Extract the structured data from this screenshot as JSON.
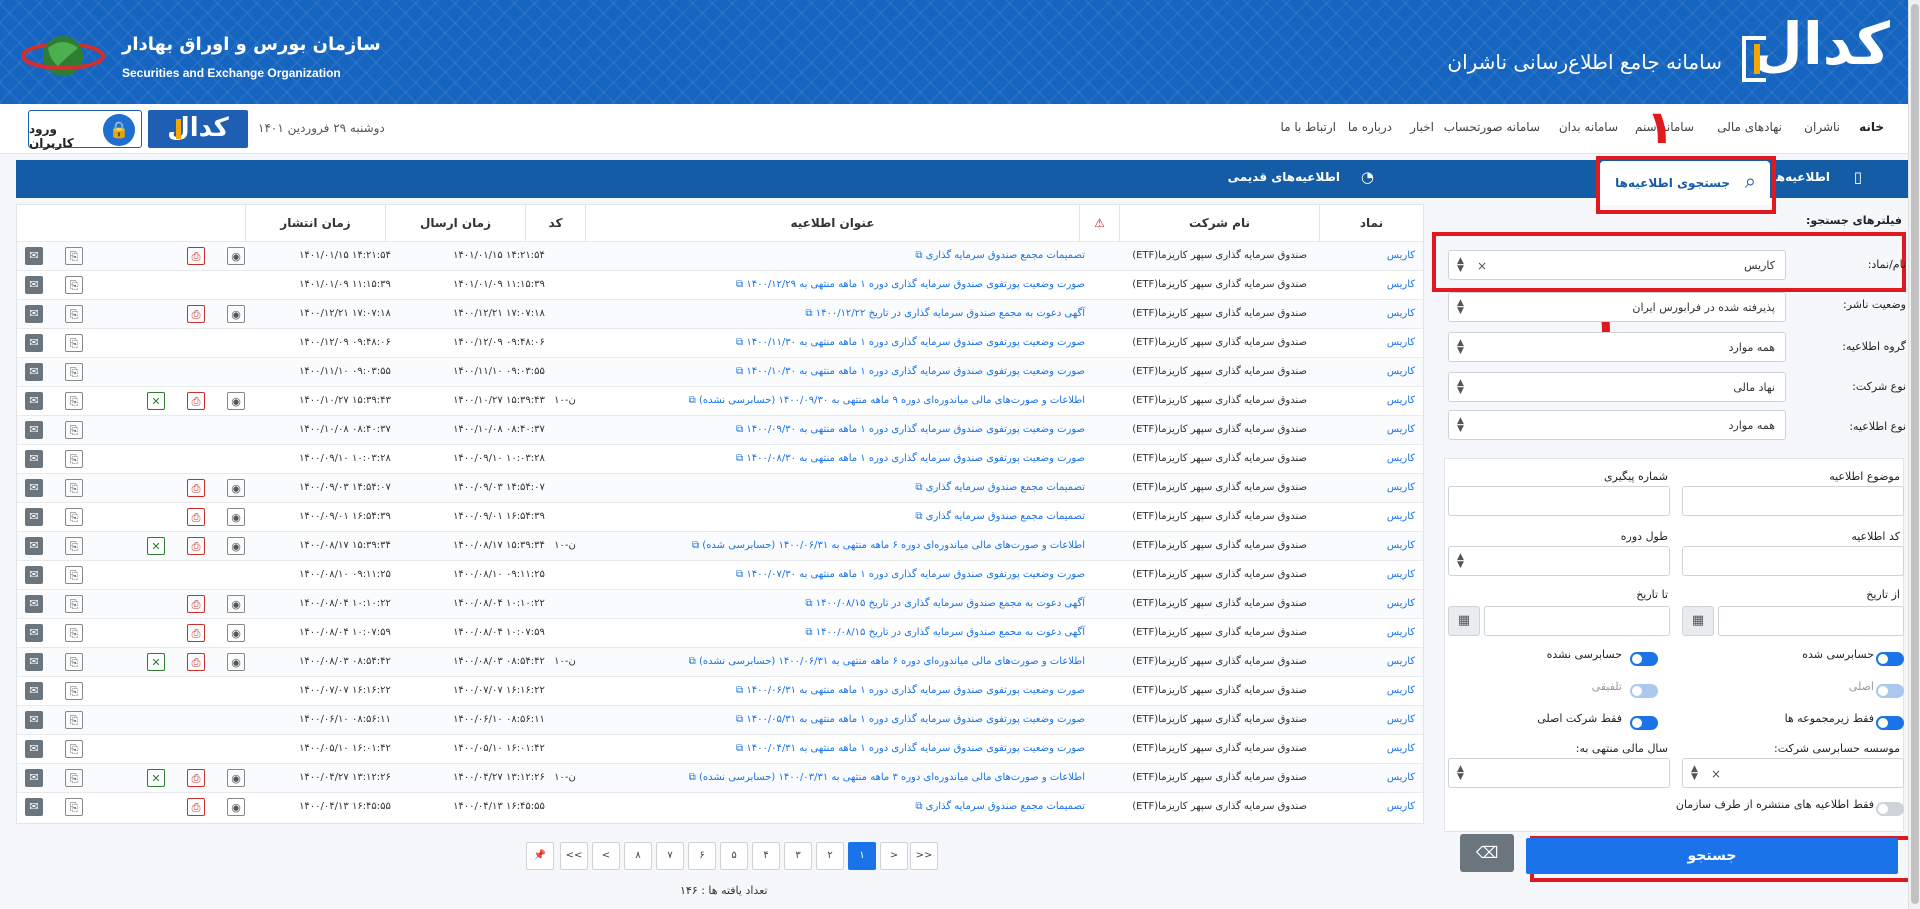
{
  "header": {
    "brand_logo": "کدال",
    "title": "سامانه جامع اطلاع‌رسانی ناشران",
    "org_fa": "سازمان بورس و اوراق بهادار",
    "org_en": "Securities and Exchange Organization"
  },
  "nav": {
    "items": [
      "خانه",
      "ناشران",
      "نهادهای مالی",
      "سامانه سنم",
      "سامانه بدان",
      "سامانه صورتحساب",
      "اخبار",
      "درباره ما",
      "ارتباط با ما"
    ],
    "login": "ورود کاربران",
    "codal_small": "کدال",
    "date": "دوشنبه ۲۹ فروردین ۱۴۰۱"
  },
  "tabs": {
    "notices": "اطلاعیه‌ها",
    "search": "جستجوی اطلاعیه‌ها",
    "old": "اطلاعیه‌های قدیمی"
  },
  "annotations": [
    "۱",
    "۲",
    "۳"
  ],
  "filters": {
    "heading": "فیلترهای جستجو:",
    "symbol_label": "نام/نماد:",
    "symbol_value": "کاریس",
    "publisher_status_label": "وضعیت ناشر:",
    "publisher_status_value": "پذیرفته شده در فرابورس ایران",
    "notice_group_label": "گروه اطلاعیه:",
    "notice_group_value": "همه موارد",
    "company_type_label": "نوع شرکت:",
    "company_type_value": "نهاد مالی",
    "notice_type_label": "نوع اطلاعیه:",
    "notice_type_value": "همه موارد",
    "subject_label": "موضوع اطلاعیه",
    "tracking_label": "شماره پیگیری",
    "code_label": "کد اطلاعیه",
    "period_label": "طول دوره",
    "from_label": "از تاریخ",
    "to_label": "تا تاریخ",
    "audited": "حسابرسی شده",
    "not_audited": "حسابرسی نشده",
    "original": "اصلی",
    "consolidated": "تلفیقی",
    "subsidiaries_only": "فقط زیرمجموعه ها",
    "parent_only": "فقط شرکت اصلی",
    "audit_firm_label": "موسسه حسابرسی شرکت:",
    "fiscal_year_label": "سال مالی منتهی به:",
    "org_only": "فقط اطلاعیه های منتشره از طرف سازمان",
    "search_btn": "جستجو"
  },
  "table": {
    "headers": {
      "symbol": "نماد",
      "company": "نام شرکت",
      "title": "عنوان اطلاعیه",
      "code": "کد",
      "sent": "زمان ارسال",
      "published": "زمان انتشار"
    },
    "rows": [
      {
        "symbol": "کاریس",
        "company": "صندوق سرمایه گذاری سپهر کاریزما(ETF)",
        "title": "تصمیمات مجمع صندوق سرمایه گذاری",
        "code": "",
        "sent": "۱۴۰۱/۰۱/۱۵ ۱۴:۲۱:۵۴",
        "pub": "۱۴۰۱/۰۱/۱۵ ۱۴:۲۱:۵۴",
        "icons": [
          "msg",
          "clip",
          "pdf",
          "eye"
        ]
      },
      {
        "symbol": "کاریس",
        "company": "صندوق سرمایه گذاری سپهر کاریزما(ETF)",
        "title": "صورت وضعیت پورتفوی صندوق سرمایه گذاری دوره ۱ ماهه منتهی به ۱۴۰۰/۱۲/۲۹",
        "code": "",
        "sent": "۱۴۰۱/۰۱/۰۹ ۱۱:۱۵:۳۹",
        "pub": "۱۴۰۱/۰۱/۰۹ ۱۱:۱۵:۳۹",
        "icons": [
          "msg",
          "clip"
        ]
      },
      {
        "symbol": "کاریس",
        "company": "صندوق سرمایه گذاری سپهر کاریزما(ETF)",
        "title": "آگهی دعوت به مجمع صندوق سرمایه گذاری در تاریخ ۱۴۰۰/۱۲/۲۲",
        "code": "",
        "sent": "۱۴۰۰/۱۲/۲۱ ۱۷:۰۷:۱۸",
        "pub": "۱۴۰۰/۱۲/۲۱ ۱۷:۰۷:۱۸",
        "icons": [
          "msg",
          "clip",
          "pdf",
          "eye"
        ]
      },
      {
        "symbol": "کاریس",
        "company": "صندوق سرمایه گذاری سپهر کاریزما(ETF)",
        "title": "صورت وضعیت پورتفوی صندوق سرمایه گذاری دوره ۱ ماهه منتهی به ۱۴۰۰/۱۱/۳۰",
        "code": "",
        "sent": "۱۴۰۰/۱۲/۰۹ ۰۹:۴۸:۰۶",
        "pub": "۱۴۰۰/۱۲/۰۹ ۰۹:۴۸:۰۶",
        "icons": [
          "msg",
          "clip"
        ]
      },
      {
        "symbol": "کاریس",
        "company": "صندوق سرمایه گذاری سپهر کاریزما(ETF)",
        "title": "صورت وضعیت پورتفوی صندوق سرمایه گذاری دوره ۱ ماهه منتهی به ۱۴۰۰/۱۰/۳۰",
        "code": "",
        "sent": "۱۴۰۰/۱۱/۱۰ ۰۹:۰۳:۵۵",
        "pub": "۱۴۰۰/۱۱/۱۰ ۰۹:۰۳:۵۵",
        "icons": [
          "msg",
          "clip"
        ]
      },
      {
        "symbol": "کاریس",
        "company": "صندوق سرمایه گذاری سپهر کاریزما(ETF)",
        "title": "اطلاعات و صورت‌های مالی میاندوره‌ای دوره ۹ ماهه منتهی به ۱۴۰۰/۰۹/۳۰ (حسابرسی نشده)",
        "code": "ن-۱۰",
        "sent": "۱۴۰۰/۱۰/۲۷ ۱۵:۳۹:۴۳",
        "pub": "۱۴۰۰/۱۰/۲۷ ۱۵:۳۹:۴۳",
        "icons": [
          "msg",
          "clip",
          "xls",
          "pdf",
          "eye"
        ]
      },
      {
        "symbol": "کاریس",
        "company": "صندوق سرمایه گذاری سپهر کاریزما(ETF)",
        "title": "صورت وضعیت پورتفوی صندوق سرمایه گذاری دوره ۱ ماهه منتهی به ۱۴۰۰/۰۹/۳۰",
        "code": "",
        "sent": "۱۴۰۰/۱۰/۰۸ ۰۸:۴۰:۳۷",
        "pub": "۱۴۰۰/۱۰/۰۸ ۰۸:۴۰:۳۷",
        "icons": [
          "msg",
          "clip"
        ]
      },
      {
        "symbol": "کاریس",
        "company": "صندوق سرمایه گذاری سپهر کاریزما(ETF)",
        "title": "صورت وضعیت پورتفوی صندوق سرمایه گذاری دوره ۱ ماهه منتهی به ۱۴۰۰/۰۸/۳۰",
        "code": "",
        "sent": "۱۴۰۰/۰۹/۱۰ ۱۰:۰۳:۲۸",
        "pub": "۱۴۰۰/۰۹/۱۰ ۱۰:۰۳:۲۸",
        "icons": [
          "msg",
          "clip"
        ]
      },
      {
        "symbol": "کاریس",
        "company": "صندوق سرمایه گذاری سپهر کاریزما(ETF)",
        "title": "تصمیمات مجمع صندوق سرمایه گذاری",
        "code": "",
        "sent": "۱۴۰۰/۰۹/۰۳ ۱۴:۵۴:۰۷",
        "pub": "۱۴۰۰/۰۹/۰۳ ۱۴:۵۴:۰۷",
        "icons": [
          "msg",
          "clip",
          "pdf",
          "eye"
        ]
      },
      {
        "symbol": "کاریس",
        "company": "صندوق سرمایه گذاری سپهر کاریزما(ETF)",
        "title": "تصمیمات مجمع صندوق سرمایه گذاری",
        "code": "",
        "sent": "۱۴۰۰/۰۹/۰۱ ۱۶:۵۴:۳۹",
        "pub": "۱۴۰۰/۰۹/۰۱ ۱۶:۵۴:۳۹",
        "icons": [
          "msg",
          "clip",
          "pdf",
          "eye"
        ]
      },
      {
        "symbol": "کاریس",
        "company": "صندوق سرمایه گذاری سپهر کاریزما(ETF)",
        "title": "اطلاعات و صورت‌های مالی میاندوره‌ای دوره ۶ ماهه منتهی به ۱۴۰۰/۰۶/۳۱ (حسابرسی شده)",
        "code": "ن-۱۰",
        "sent": "۱۴۰۰/۰۸/۱۷ ۱۵:۳۹:۳۴",
        "pub": "۱۴۰۰/۰۸/۱۷ ۱۵:۳۹:۳۴",
        "icons": [
          "msg",
          "clip",
          "xls",
          "pdf",
          "eye"
        ]
      },
      {
        "symbol": "کاریس",
        "company": "صندوق سرمایه گذاری سپهر کاریزما(ETF)",
        "title": "صورت وضعیت پورتفوی صندوق سرمایه گذاری دوره ۱ ماهه منتهی به ۱۴۰۰/۰۷/۳۰",
        "code": "",
        "sent": "۱۴۰۰/۰۸/۱۰ ۰۹:۱۱:۲۵",
        "pub": "۱۴۰۰/۰۸/۱۰ ۰۹:۱۱:۲۵",
        "icons": [
          "msg",
          "clip"
        ]
      },
      {
        "symbol": "کاریس",
        "company": "صندوق سرمایه گذاری سپهر کاریزما(ETF)",
        "title": "آگهی دعوت به مجمع صندوق سرمایه گذاری در تاریخ ۱۴۰۰/۰۸/۱۵",
        "code": "",
        "sent": "۱۴۰۰/۰۸/۰۴ ۱۰:۱۰:۲۲",
        "pub": "۱۴۰۰/۰۸/۰۴ ۱۰:۱۰:۲۲",
        "icons": [
          "msg",
          "clip",
          "pdf",
          "eye"
        ]
      },
      {
        "symbol": "کاریس",
        "company": "صندوق سرمایه گذاری سپهر کاریزما(ETF)",
        "title": "آگهی دعوت به مجمع صندوق سرمایه گذاری در تاریخ ۱۴۰۰/۰۸/۱۵",
        "code": "",
        "sent": "۱۴۰۰/۰۸/۰۴ ۱۰:۰۷:۵۹",
        "pub": "۱۴۰۰/۰۸/۰۴ ۱۰:۰۷:۵۹",
        "icons": [
          "msg",
          "clip",
          "pdf",
          "eye"
        ]
      },
      {
        "symbol": "کاریس",
        "company": "صندوق سرمایه گذاری سپهر کاریزما(ETF)",
        "title": "اطلاعات و صورت‌های مالی میاندوره‌ای دوره ۶ ماهه منتهی به ۱۴۰۰/۰۶/۳۱ (حسابرسی نشده)",
        "code": "ن-۱۰",
        "sent": "۱۴۰۰/۰۸/۰۳ ۰۸:۵۴:۴۲",
        "pub": "۱۴۰۰/۰۸/۰۳ ۰۸:۵۴:۴۲",
        "icons": [
          "msg",
          "clip",
          "xls",
          "pdf",
          "eye"
        ]
      },
      {
        "symbol": "کاریس",
        "company": "صندوق سرمایه گذاری سپهر کاریزما(ETF)",
        "title": "صورت وضعیت پورتفوی صندوق سرمایه گذاری دوره ۱ ماهه منتهی به ۱۴۰۰/۰۶/۳۱",
        "code": "",
        "sent": "۱۴۰۰/۰۷/۰۷ ۱۶:۱۶:۲۲",
        "pub": "۱۴۰۰/۰۷/۰۷ ۱۶:۱۶:۲۲",
        "icons": [
          "msg",
          "clip"
        ]
      },
      {
        "symbol": "کاریس",
        "company": "صندوق سرمایه گذاری سپهر کاریزما(ETF)",
        "title": "صورت وضعیت پورتفوی صندوق سرمایه گذاری دوره ۱ ماهه منتهی به ۱۴۰۰/۰۵/۳۱",
        "code": "",
        "sent": "۱۴۰۰/۰۶/۱۰ ۰۸:۵۶:۱۱",
        "pub": "۱۴۰۰/۰۶/۱۰ ۰۸:۵۶:۱۱",
        "icons": [
          "msg",
          "clip"
        ]
      },
      {
        "symbol": "کاریس",
        "company": "صندوق سرمایه گذاری سپهر کاریزما(ETF)",
        "title": "صورت وضعیت پورتفوی صندوق سرمایه گذاری دوره ۱ ماهه منتهی به ۱۴۰۰/۰۴/۳۱",
        "code": "",
        "sent": "۱۴۰۰/۰۵/۱۰ ۱۶:۰۱:۴۲",
        "pub": "۱۴۰۰/۰۵/۱۰ ۱۶:۰۱:۴۲",
        "icons": [
          "msg",
          "clip"
        ]
      },
      {
        "symbol": "کاریس",
        "company": "صندوق سرمایه گذاری سپهر کاریزما(ETF)",
        "title": "اطلاعات و صورت‌های مالی میاندوره‌ای دوره ۳ ماهه منتهی به ۱۴۰۰/۰۳/۳۱ (حسابرسی نشده)",
        "code": "ن-۱۰",
        "sent": "۱۴۰۰/۰۴/۲۷ ۱۳:۱۲:۲۶",
        "pub": "۱۴۰۰/۰۴/۲۷ ۱۳:۱۲:۲۶",
        "icons": [
          "msg",
          "clip",
          "xls",
          "pdf",
          "eye"
        ]
      },
      {
        "symbol": "کاریس",
        "company": "صندوق سرمایه گذاری سپهر کاریزما(ETF)",
        "title": "تصمیمات مجمع صندوق سرمایه گذاری",
        "code": "",
        "sent": "۱۴۰۰/۰۴/۱۳ ۱۶:۴۵:۵۵",
        "pub": "۱۴۰۰/۰۴/۱۳ ۱۶:۴۵:۵۵",
        "icons": [
          "msg",
          "clip",
          "pdf",
          "eye"
        ]
      }
    ]
  },
  "pagination": {
    "pages": [
      "۱",
      "۲",
      "۳",
      "۴",
      "۵",
      "۶",
      "۷",
      "۸"
    ],
    "current": "۱",
    "next": ">",
    "last": ">>",
    "prev": "<",
    "first": "<<",
    "found": "تعداد یافته ها : ۱۴۶"
  },
  "colors": {
    "brand": "#1565c0",
    "accent": "#1a73e8",
    "annotation": "#e0191f"
  }
}
